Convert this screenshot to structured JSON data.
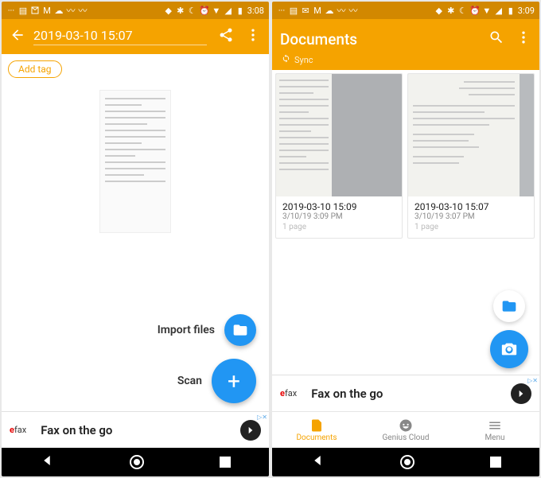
{
  "left": {
    "status": {
      "time": "3:08"
    },
    "appbar": {
      "title": "2019-03-10 15:07"
    },
    "add_tag_label": "Add tag",
    "fab": {
      "import_label": "Import files",
      "scan_label": "Scan"
    },
    "ad": {
      "brand_prefix": "e",
      "brand_suffix": "fax",
      "text": "Fax on the go"
    }
  },
  "right": {
    "status": {
      "time": "3:09"
    },
    "appbar": {
      "title": "Documents",
      "sync_label": "Sync"
    },
    "cards": [
      {
        "title": "2019-03-10 15:09",
        "subtitle": "3/10/19 3:09 PM",
        "pages": "1 page"
      },
      {
        "title": "2019-03-10 15:07",
        "subtitle": "3/10/19 3:07 PM",
        "pages": "1 page"
      }
    ],
    "ad": {
      "brand_prefix": "e",
      "brand_suffix": "fax",
      "text": "Fax on the go"
    },
    "tabs": {
      "documents": "Documents",
      "genius": "Genius Cloud",
      "menu": "Menu"
    }
  }
}
